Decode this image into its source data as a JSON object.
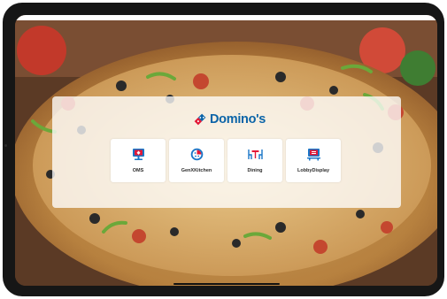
{
  "brand": {
    "name": "Domino's",
    "logo_icon": "dominos-domino-logo-icon",
    "colors": {
      "blue": "#0b64a8",
      "red": "#e31837",
      "white": "#ffffff"
    }
  },
  "apps": [
    {
      "label": "OMS",
      "icon": "monitor-stand-icon"
    },
    {
      "label": "GenXKitchen",
      "icon": "pizza-slice-icon"
    },
    {
      "label": "Dining",
      "icon": "dining-table-chairs-icon"
    },
    {
      "label": "LobbyDisplay",
      "icon": "lobby-display-screen-icon"
    }
  ],
  "theme": {
    "icon_blue": "#1976c8",
    "icon_red": "#e31837",
    "panel_bg": "rgba(255,255,255,0.78)"
  }
}
